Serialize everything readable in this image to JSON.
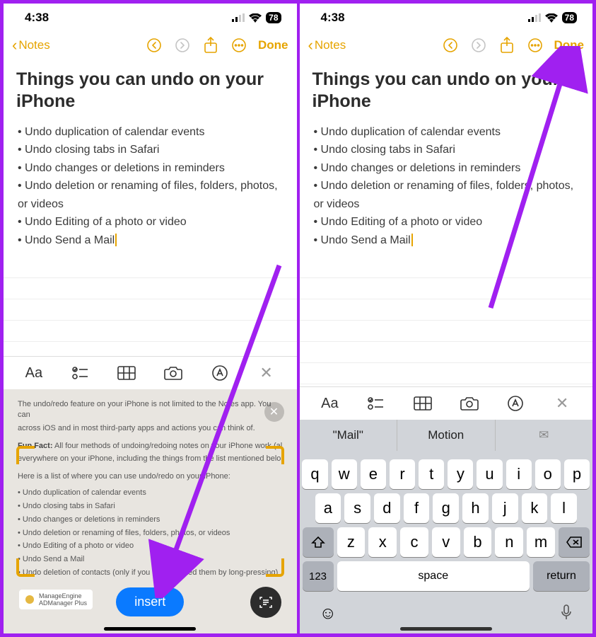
{
  "statusbar": {
    "time": "4:38",
    "battery": "78"
  },
  "nav": {
    "back_label": "Notes",
    "done_label": "Done"
  },
  "note": {
    "title": "Things you can undo on your iPhone",
    "bullets": [
      "Undo duplication of calendar events",
      "Undo closing tabs in Safari",
      "Undo changes or deletions in reminders",
      "Undo deletion or renaming of files, folders, photos, or videos",
      "Undo Editing of a photo or video",
      "Undo Send a Mail"
    ]
  },
  "format_bar": {
    "aa": "Aa"
  },
  "scan": {
    "line1": "The undo/redo feature on your iPhone is not limited to the Notes app. You can",
    "line2": "across iOS and in most third-party apps and actions you can think of.",
    "funfact_label": "Fun Fact:",
    "funfact": "All four methods of undoing/redoing notes on your iPhone work (al",
    "funfact2": "everywhere on your iPhone, including the things from the list mentioned belo",
    "listintro": "Here is a list of where you can use undo/redo on your iPhone:",
    "bullets": [
      "Undo duplication of calendar events",
      "Undo closing tabs in Safari",
      "Undo changes or deletions in reminders",
      "Undo deletion or renaming of files, folders, photos, or videos",
      "Undo Editing of a photo or video",
      "Undo Send a Mail",
      "Undo deletion of contacts (only if you have deleted them by long-pressing)"
    ],
    "banner1": "ManageEngine",
    "banner2": "ADManager Plus",
    "insert_label": "insert"
  },
  "suggestions": [
    "\"Mail\"",
    "Motion",
    "✉"
  ],
  "keyboard": {
    "row1": [
      "q",
      "w",
      "e",
      "r",
      "t",
      "y",
      "u",
      "i",
      "o",
      "p"
    ],
    "row2": [
      "a",
      "s",
      "d",
      "f",
      "g",
      "h",
      "j",
      "k",
      "l"
    ],
    "row3": [
      "z",
      "x",
      "c",
      "v",
      "b",
      "n",
      "m"
    ],
    "num_label": "123",
    "space_label": "space",
    "return_label": "return"
  }
}
